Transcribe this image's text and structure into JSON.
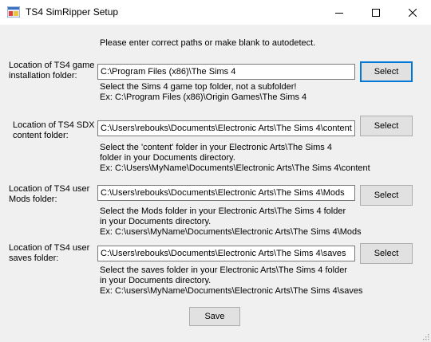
{
  "window": {
    "title": "TS4 SimRipper Setup",
    "icon": "app-icon",
    "controls": [
      "minimize-icon",
      "maximize-icon",
      "close-icon"
    ]
  },
  "intro": "Please enter correct paths or make blank to autodetect.",
  "sections": [
    {
      "label_line1": "Location of TS4 game",
      "label_line2": "installation folder:",
      "value": "C:\\Program Files (x86)\\The Sims 4",
      "button": "Select",
      "help": [
        "Select the Sims 4 game top folder, not a subfolder!",
        "Ex: C:\\Program Files (x86)\\Origin Games\\The Sims 4"
      ]
    },
    {
      "label_line1": "Location of TS4 SDX",
      "label_line2": "content folder:",
      "value": "C:\\Users\\rebouks\\Documents\\Electronic Arts\\The Sims 4\\content",
      "button": "Select",
      "help": [
        "Select the 'content' folder in your Electronic Arts\\The Sims 4",
        "folder in your Documents directory.",
        "Ex: C:\\Users\\MyName\\Documents\\Electronic Arts\\The Sims 4\\content"
      ]
    },
    {
      "label_line1": "Location of TS4 user",
      "label_line2": "Mods folder:",
      "value": "C:\\Users\\rebouks\\Documents\\Electronic Arts\\The Sims 4\\Mods",
      "button": "Select",
      "help": [
        "Select the Mods folder in your Electronic Arts\\The Sims 4 folder",
        "in your Documents directory.",
        "Ex: C:\\users\\MyName\\Documents\\Electronic Arts\\The Sims 4\\Mods"
      ]
    },
    {
      "label_line1": "Location of TS4 user",
      "label_line2": "saves folder:",
      "value": "C:\\Users\\rebouks\\Documents\\Electronic Arts\\The Sims 4\\saves",
      "button": "Select",
      "help": [
        "Select the saves folder in your Electronic Arts\\The Sims 4 folder",
        "in your Documents directory.",
        "Ex: C:\\users\\MyName\\Documents\\Electronic Arts\\The Sims 4\\saves"
      ]
    }
  ],
  "save_label": "Save",
  "colors": {
    "focus_accent": "#0078d7",
    "client_bg": "#f0f0f0",
    "button_bg": "#e1e1e1"
  }
}
